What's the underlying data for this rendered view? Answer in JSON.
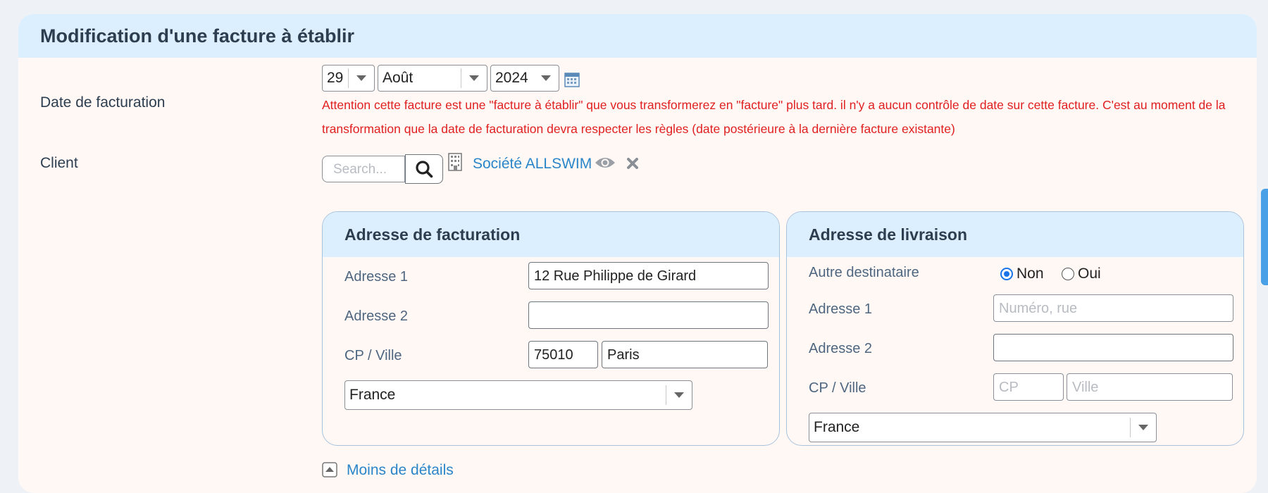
{
  "header": {
    "title": "Modification d'une facture à établir"
  },
  "billing_date": {
    "label": "Date de facturation",
    "day": "29",
    "month": "Août",
    "year": "2024",
    "warning": "Attention cette facture est une \"facture à établir\" que vous transformerez en \"facture\" plus tard. il n'y a aucun contrôle de date sur cette facture. C'est au moment de la transformation que la date de facturation devra respecter les règles (date postérieure à la dernière facture existante)"
  },
  "client": {
    "label": "Client",
    "search_placeholder": "Search...",
    "name": "Société ALLSWIM"
  },
  "billing_address": {
    "title": "Adresse de facturation",
    "address1_label": "Adresse 1",
    "address1": "12 Rue Philippe de Girard",
    "address2_label": "Adresse 2",
    "address2": "",
    "cp_city_label": "CP / Ville",
    "cp": "75010",
    "city": "Paris",
    "country": "France"
  },
  "delivery_address": {
    "title": "Adresse de livraison",
    "other_recipient_label": "Autre destinataire",
    "option_no": "Non",
    "option_yes": "Oui",
    "selected": "Non",
    "address1_label": "Adresse 1",
    "address1_placeholder": "Numéro, rue",
    "address2_label": "Adresse 2",
    "cp_city_label": "CP / Ville",
    "cp_placeholder": "CP",
    "city_placeholder": "Ville",
    "country": "France"
  },
  "details_link": "Moins de détails",
  "colors": {
    "header_bg": "#dcefff",
    "link": "#2a86c9",
    "warning": "#e02020",
    "radio_accent": "#1a73e8"
  }
}
